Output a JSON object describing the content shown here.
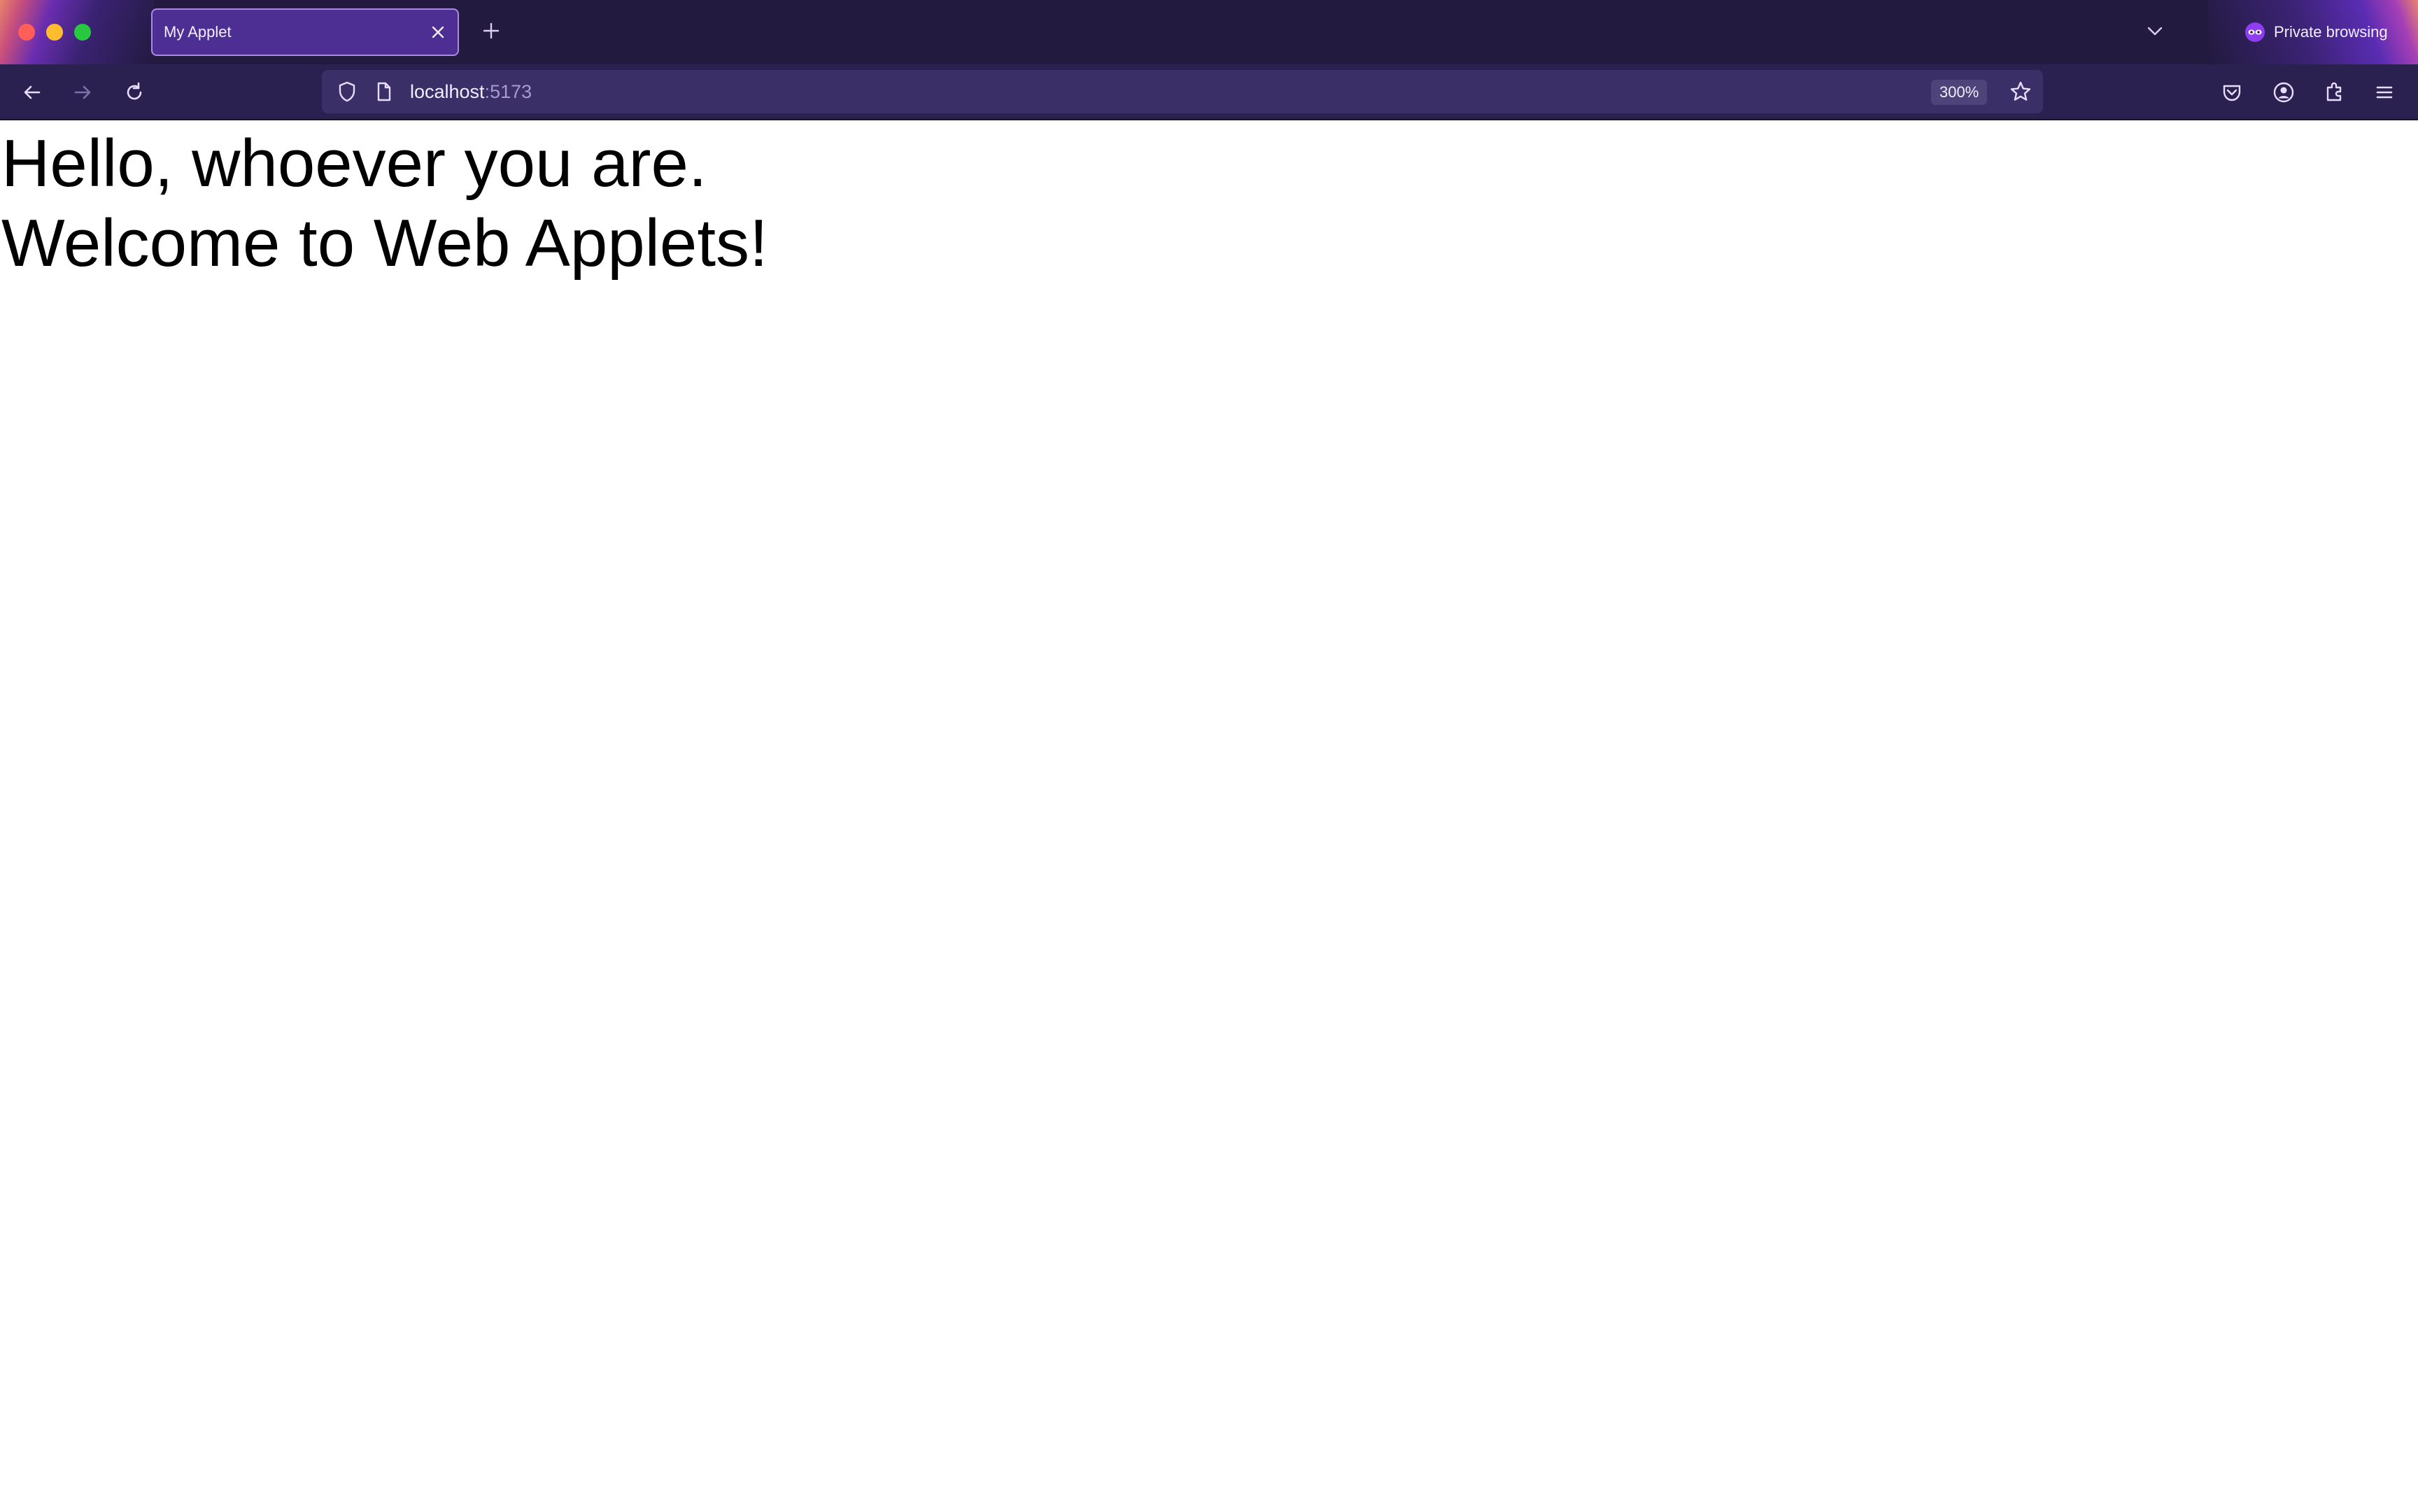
{
  "browser": {
    "tab": {
      "title": "My Applet"
    },
    "private_label": "Private browsing",
    "address": {
      "host": "localhost",
      "port": ":5173"
    },
    "zoom": "300%"
  },
  "page": {
    "lines": [
      "Hello, whoever you are.",
      "Welcome to Web Applets!"
    ]
  },
  "icons": [
    "close-icon",
    "plus-icon",
    "chevron-down-icon",
    "mask-icon",
    "back-arrow-icon",
    "forward-arrow-icon",
    "reload-icon",
    "shield-icon",
    "page-icon",
    "star-icon",
    "pocket-icon",
    "account-icon",
    "extensions-icon",
    "menu-icon"
  ],
  "colors": {
    "chrome_dark": "#221a3f",
    "toolbar": "#2b2150",
    "tab_active": "#4d2e93",
    "accent": "#a98be6"
  }
}
